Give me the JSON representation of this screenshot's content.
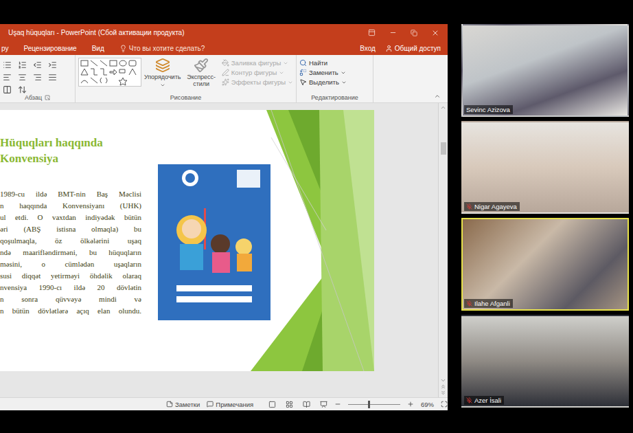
{
  "window": {
    "title": "Uşaq hüquqları - PowerPoint (Сбой активации продукта)"
  },
  "menu_tabs": [
    "ру",
    "Рецензирование",
    "Вид"
  ],
  "tell_me": {
    "placeholder": "Что вы хотите сделать?"
  },
  "sign_in": "Вход",
  "share": "Общий доступ",
  "ribbon": {
    "paragraph_group": "Абзац",
    "drawing_group": "Рисование",
    "editing_group": "Редактирование",
    "arrange": "Упорядочить",
    "quick_styles": "Экспресс-стили",
    "shape_commands": [
      {
        "label": "Заливка фигуры",
        "disabled": true
      },
      {
        "label": "Контур фигуры",
        "disabled": true
      },
      {
        "label": "Эффекты фигуры",
        "disabled": true
      }
    ],
    "editing_commands": [
      "Найти",
      "Заменить",
      "Выделить"
    ]
  },
  "slide": {
    "title_lines": [
      "Hüquqları haqqında",
      "Konvensiya"
    ],
    "paragraph_lines": [
      "1989-cu ildə BMT-nin Baş Məclisi",
      "n haqqında Konvensiyanı (UHK)",
      "ul etdi. O vaxtdan indiyədək bütün",
      "əri (ABŞ istisna olmaqla) bu",
      "qoşulmaqla, öz ölkələrini uşaq",
      "ndə maarifləndirməni, bu hüquqların",
      "məsini, o cümlədən uşaqların",
      "susi diqqət yetirməyi öhdəlik olaraq",
      "nvensiya 1990-cı ildə 20 dövlətin",
      "n sonra qüvvəyə mindi və",
      "n bütün dövlətlərə açıq elan olundu."
    ]
  },
  "status_bar": {
    "notes": "Заметки",
    "comments": "Примечания",
    "zoom": "69%",
    "zoom_level": 0.38
  },
  "participants": [
    {
      "name": "Sevinc Azizova",
      "muted": false,
      "selected": false
    },
    {
      "name": "Nigar Agayeva",
      "muted": true,
      "selected": false
    },
    {
      "name": "Ilahe Afganli",
      "muted": true,
      "selected": true
    },
    {
      "name": "Azer İsali",
      "muted": true,
      "selected": false
    }
  ]
}
